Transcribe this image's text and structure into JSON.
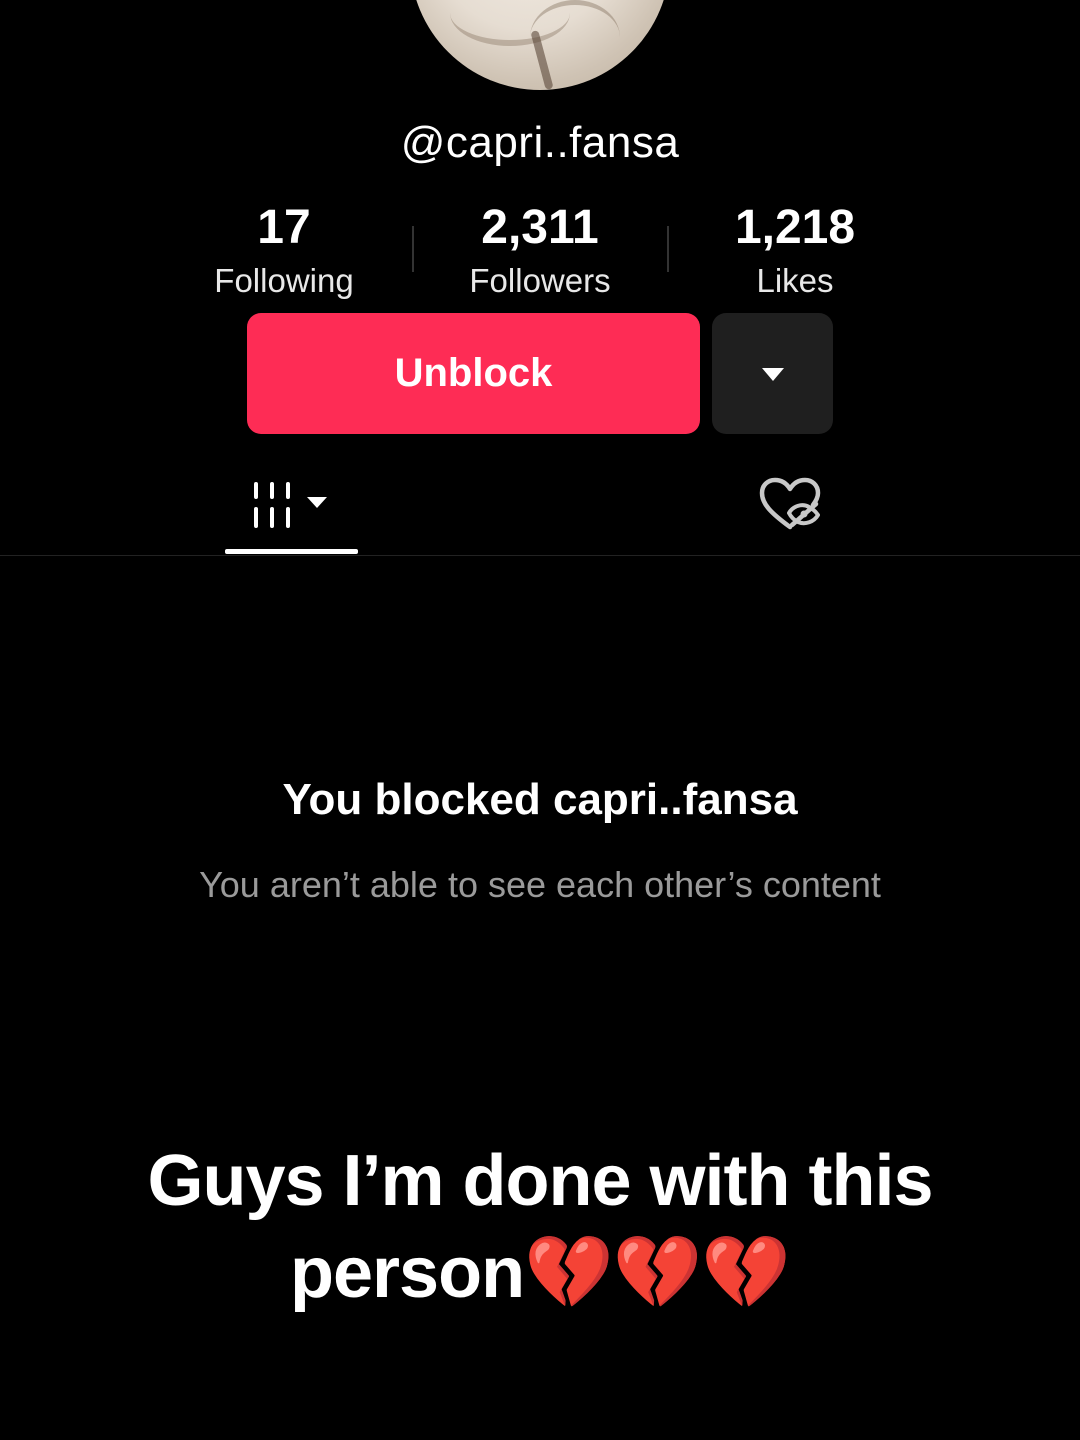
{
  "profile": {
    "username": "@capri..fansa",
    "stats": [
      {
        "value": "17",
        "label": "Following"
      },
      {
        "value": "2,311",
        "label": "Followers"
      },
      {
        "value": "1,218",
        "label": "Likes"
      }
    ]
  },
  "actions": {
    "unblock_label": "Unblock",
    "more_icon": "caret-down-icon"
  },
  "tabs": [
    {
      "icon": "videos-grid-icon",
      "active": true
    },
    {
      "icon": "liked-hidden-icon",
      "active": false
    }
  ],
  "blocked_notice": {
    "title": "You blocked capri..fansa",
    "subtitle": "You aren’t able to see each other’s content"
  },
  "caption": {
    "line1": "Guys I’m done with this",
    "line2": "person💔💔💔"
  },
  "colors": {
    "accent": "#fe2c55",
    "background": "#000000",
    "secondary_button": "#1f1f1f"
  }
}
